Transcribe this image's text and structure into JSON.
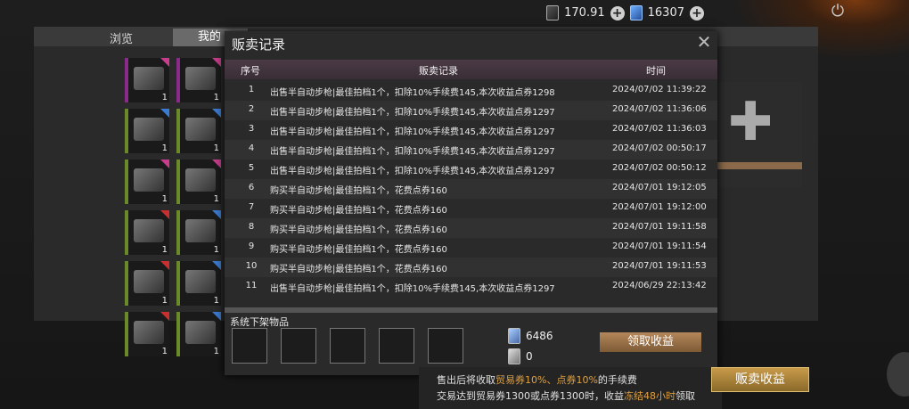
{
  "topbar": {
    "currency1": "170.91",
    "currency2": "16307"
  },
  "under": {
    "tab_browse": "浏览",
    "tab_mine": "我的",
    "slots_qty": [
      "1",
      "1",
      "1",
      "1",
      "1",
      "1",
      "1",
      "1",
      "1",
      "1",
      "1",
      "1"
    ]
  },
  "modal": {
    "title": "贩卖记录",
    "headers": {
      "index": "序号",
      "record": "贩卖记录",
      "time": "时间"
    },
    "rows": [
      {
        "index": "1",
        "record": "出售半自动步枪|最佳拍档1个，扣除10%手续费145,本次收益点券1298",
        "time": "2024/07/02 11:39:22"
      },
      {
        "index": "2",
        "record": "出售半自动步枪|最佳拍档1个，扣除10%手续费145,本次收益点券1297",
        "time": "2024/07/02 11:36:06"
      },
      {
        "index": "3",
        "record": "出售半自动步枪|最佳拍档1个，扣除10%手续费145,本次收益点券1297",
        "time": "2024/07/02 11:36:03"
      },
      {
        "index": "4",
        "record": "出售半自动步枪|最佳拍档1个，扣除10%手续费145,本次收益点券1297",
        "time": "2024/07/02 00:50:17"
      },
      {
        "index": "5",
        "record": "出售半自动步枪|最佳拍档1个，扣除10%手续费145,本次收益点券1297",
        "time": "2024/07/02 00:50:12"
      },
      {
        "index": "6",
        "record": "购买半自动步枪|最佳拍档1个，花费点券160",
        "time": "2024/07/01 19:12:05"
      },
      {
        "index": "7",
        "record": "购买半自动步枪|最佳拍档1个，花费点券160",
        "time": "2024/07/01 19:12:00"
      },
      {
        "index": "8",
        "record": "购买半自动步枪|最佳拍档1个，花费点券160",
        "time": "2024/07/01 19:11:58"
      },
      {
        "index": "9",
        "record": "购买半自动步枪|最佳拍档1个，花费点券160",
        "time": "2024/07/01 19:11:54"
      },
      {
        "index": "10",
        "record": "购买半自动步枪|最佳拍档1个，花费点券160",
        "time": "2024/07/01 19:11:53"
      },
      {
        "index": "11",
        "record": "出售半自动步枪|最佳拍档1个，扣除10%手续费145,本次收益点券1297",
        "time": "2024/06/29 22:13:42"
      }
    ],
    "sys_label": "系统下架物品",
    "res1": "6486",
    "res2": "0",
    "claim_label": "领取收益"
  },
  "notice": {
    "l1_a": "售出后将收取",
    "l1_b": "贸易券10%、点券10%",
    "l1_c": "的手续费",
    "l2_a": "交易达到贸易券1300或点券1300时，收益",
    "l2_b": "冻结48小时",
    "l2_c": "领取"
  },
  "sell_income_label": "贩卖收益",
  "colors": {
    "accent": "#b4875a",
    "highlight": "#e0a040",
    "header": "#4a3a45"
  }
}
